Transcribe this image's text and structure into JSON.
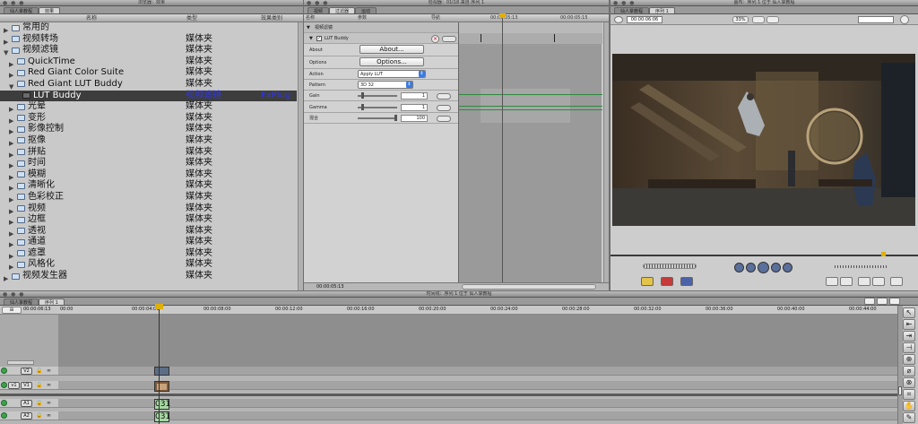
{
  "browser": {
    "window_title": "浏览器：效果",
    "tabs": [
      "仙人掌教程",
      "效果"
    ],
    "columns": {
      "name": "名称",
      "type": "类型",
      "effect_type": "效果类别"
    },
    "items": [
      {
        "label": "常用的",
        "type": "",
        "effect_type": "",
        "level": 0,
        "icon": "folder-icon",
        "expanded": false
      },
      {
        "label": "视频转场",
        "type": "媒体夹",
        "effect_type": "",
        "level": 0,
        "icon": "bin-icon",
        "expanded": false
      },
      {
        "label": "视频滤镜",
        "type": "媒体夹",
        "effect_type": "",
        "level": 0,
        "icon": "bin-icon",
        "expanded": true
      },
      {
        "label": "QuickTime",
        "type": "媒体夹",
        "effect_type": "",
        "level": 1,
        "icon": "bin-icon",
        "expanded": false
      },
      {
        "label": "Red Giant Color Suite",
        "type": "媒体夹",
        "effect_type": "",
        "level": 1,
        "icon": "bin-icon",
        "expanded": false
      },
      {
        "label": "Red Giant LUT Buddy",
        "type": "媒体夹",
        "effect_type": "",
        "level": 1,
        "icon": "bin-icon",
        "expanded": true
      },
      {
        "label": "LUT Buddy",
        "type": "视频滤镜",
        "effect_type": "FxPlug",
        "level": 2,
        "icon": "filter-icon",
        "selected": true
      },
      {
        "label": "光晕",
        "type": "媒体夹",
        "effect_type": "",
        "level": 1,
        "icon": "bin-icon"
      },
      {
        "label": "变形",
        "type": "媒体夹",
        "effect_type": "",
        "level": 1,
        "icon": "bin-icon"
      },
      {
        "label": "影像控制",
        "type": "媒体夹",
        "effect_type": "",
        "level": 1,
        "icon": "bin-icon"
      },
      {
        "label": "抠像",
        "type": "媒体夹",
        "effect_type": "",
        "level": 1,
        "icon": "bin-icon"
      },
      {
        "label": "拼贴",
        "type": "媒体夹",
        "effect_type": "",
        "level": 1,
        "icon": "bin-icon"
      },
      {
        "label": "时间",
        "type": "媒体夹",
        "effect_type": "",
        "level": 1,
        "icon": "bin-icon"
      },
      {
        "label": "模糊",
        "type": "媒体夹",
        "effect_type": "",
        "level": 1,
        "icon": "bin-icon"
      },
      {
        "label": "清晰化",
        "type": "媒体夹",
        "effect_type": "",
        "level": 1,
        "icon": "bin-icon"
      },
      {
        "label": "色彩校正",
        "type": "媒体夹",
        "effect_type": "",
        "level": 1,
        "icon": "bin-icon"
      },
      {
        "label": "视频",
        "type": "媒体夹",
        "effect_type": "",
        "level": 1,
        "icon": "bin-icon"
      },
      {
        "label": "边框",
        "type": "媒体夹",
        "effect_type": "",
        "level": 1,
        "icon": "bin-icon"
      },
      {
        "label": "透视",
        "type": "媒体夹",
        "effect_type": "",
        "level": 1,
        "icon": "bin-icon"
      },
      {
        "label": "通道",
        "type": "媒体夹",
        "effect_type": "",
        "level": 1,
        "icon": "bin-icon"
      },
      {
        "label": "遮罩",
        "type": "媒体夹",
        "effect_type": "",
        "level": 1,
        "icon": "bin-icon"
      },
      {
        "label": "风格化",
        "type": "媒体夹",
        "effect_type": "",
        "level": 1,
        "icon": "bin-icon"
      },
      {
        "label": "视频发生器",
        "type": "媒体夹",
        "effect_type": "",
        "level": 0,
        "icon": "bin-icon"
      }
    ]
  },
  "effects": {
    "window_title": "检视器：01I18 来自 序列 1",
    "tabs": [
      "视频",
      "过滤器",
      "运动"
    ],
    "columns": {
      "name": "名称",
      "params": "参数",
      "nav": "导航"
    },
    "timecode_top": "00:00:05:13",
    "timecode_top2": "00:00:05:15",
    "group_label": "视频滤镜",
    "filter_name": "LUT Buddy",
    "rows": [
      {
        "label": "About",
        "control": "About..."
      },
      {
        "label": "Options",
        "control": "Options..."
      },
      {
        "label": "Action",
        "value": "Apply LUT"
      },
      {
        "label": "Pattern",
        "value": "3D 32"
      },
      {
        "label": "Gain",
        "value": "1"
      },
      {
        "label": "Gamma",
        "value": "1"
      },
      {
        "label": "混合",
        "value": "100"
      }
    ],
    "timecode_bottom": "00:00:05:13"
  },
  "canvas": {
    "window_title": "画布：序列 1 位于 仙人掌教程",
    "tabs": [
      "仙人掌教程",
      "序列 1"
    ],
    "timecode": "00:00:06:06",
    "zoom": "33%",
    "colors": {
      "scene_dark": "#2a2a26",
      "scene_warm": "#5a4a36"
    }
  },
  "timeline": {
    "window_title": "时间线：序列 1 位于 仙人掌教程",
    "tabs": [
      "仙人掌教程",
      "序列 1"
    ],
    "timecode": "00:00:06:13",
    "ruler": [
      "00:00",
      "00:00:04:00",
      "00:00:08:00",
      "00:00:12:00",
      "00:00:16:00",
      "00:00:20:00",
      "00:00:24:00",
      "00:00:28:00",
      "00:00:32:00",
      "00:00:36:00",
      "00:00:40:00",
      "00:00:44:00"
    ],
    "tracks": [
      {
        "dest": "",
        "name": "V2"
      },
      {
        "dest": "v1",
        "name": "V1"
      },
      {
        "dest": "a1",
        "name": "A1"
      },
      {
        "dest": "a2",
        "name": "A2"
      }
    ],
    "clip_label": "031"
  }
}
